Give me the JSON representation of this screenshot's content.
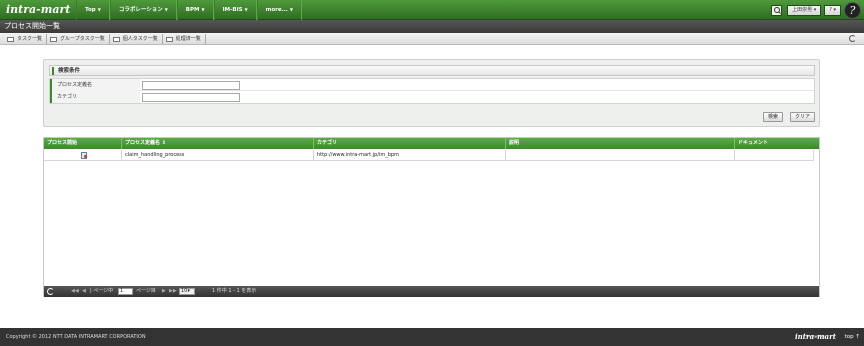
{
  "header": {
    "logo": "intra-mart",
    "nav": [
      "Top",
      "コラボレーション",
      "BPM",
      "IM-BIS",
      "more..."
    ],
    "user": "上田崇男",
    "help": "?"
  },
  "title": "プロセス開始一覧",
  "tabs": [
    "タスク一覧",
    "グループタスク一覧",
    "個人タスク一覧",
    "処理済一覧"
  ],
  "search": {
    "header": "検索条件",
    "fields": [
      {
        "label": "プロセス定義名",
        "value": ""
      },
      {
        "label": "カテゴリ",
        "value": ""
      }
    ],
    "search_button": "検索",
    "clear_button": "クリア"
  },
  "grid": {
    "columns": [
      "プロセス開始",
      "プロセス定義名 ⇕",
      "カテゴリ",
      "説明",
      "ドキュメント"
    ],
    "rows": [
      {
        "name": "claim_handling_process",
        "category": "http://www.intra-mart.jp/im_bpm",
        "description": "",
        "document": ""
      }
    ]
  },
  "pager": {
    "page_prefix": "| ページ中",
    "page_value": "1",
    "page_suffix": "ページ目",
    "page_size": "10",
    "summary": "1 件中 1 - 1 を表示"
  },
  "footer": {
    "copyright": "Copyright © 2012 NTT DATA INTRAMART CORPORATION",
    "powered": "Powered by",
    "logo": "intra-mart",
    "top_link": "top ↑"
  }
}
